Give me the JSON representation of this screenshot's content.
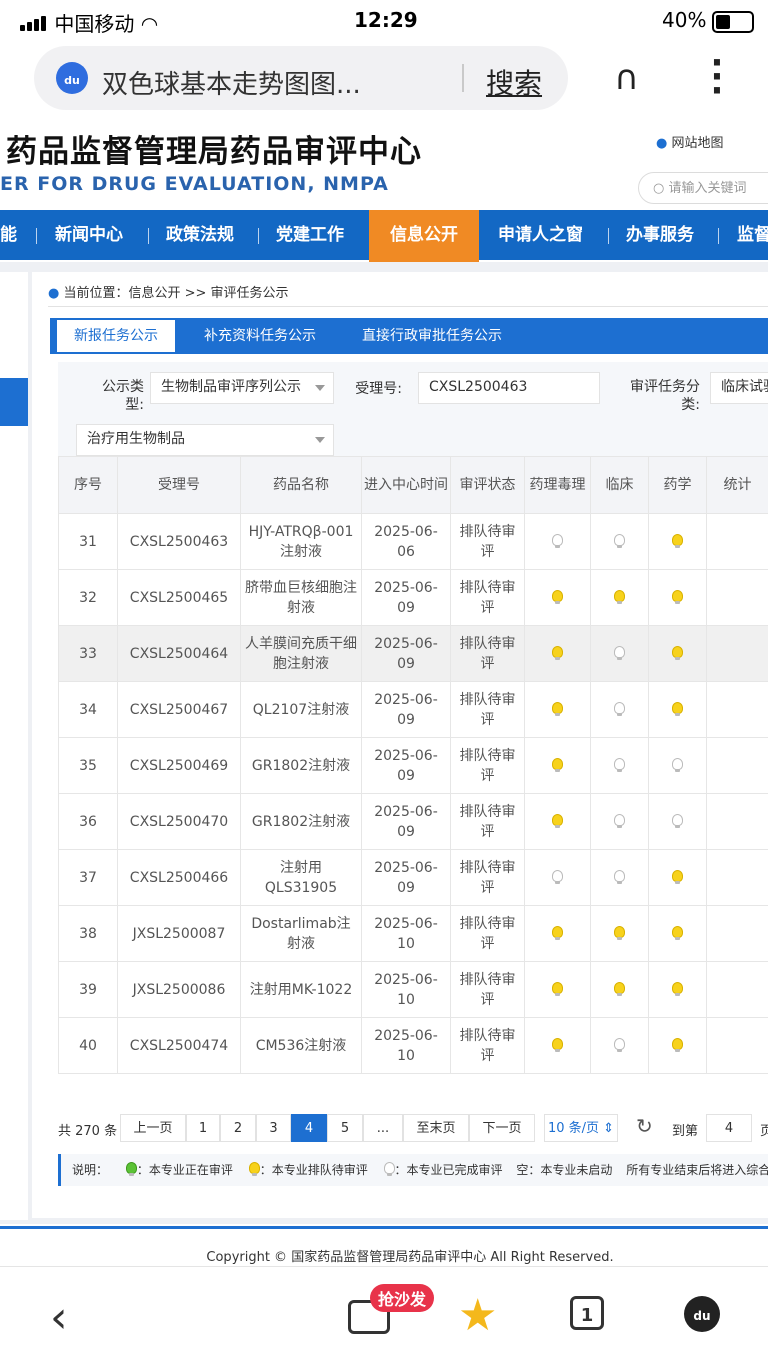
{
  "status_bar": {
    "carrier": "中国移动",
    "time": "12:29",
    "battery": "40%"
  },
  "browser": {
    "search_text": "双色球基本走势图图...",
    "search_button": "搜索",
    "logo_text": "du"
  },
  "site": {
    "title": "药品监督管理局药品审评中心",
    "subtitle": "ER FOR DRUG EVALUATION, NMPA",
    "sitemap": "网站地图",
    "search_placeholder": "请输入关键词"
  },
  "nav": {
    "items": [
      "能",
      "新闻中心",
      "政策法规",
      "党建工作",
      "信息公开",
      "申请人之窗",
      "办事服务",
      "监督"
    ],
    "active": "信息公开"
  },
  "breadcrumb": "当前位置：信息公开 >> 审评任务公示",
  "tabs": [
    "新报任务公示",
    "补充资料任务公示",
    "直接行政审批任务公示"
  ],
  "filters": {
    "type_label": "公示类型:",
    "type_value": "生物制品审评序列公示",
    "accept_label": "受理号:",
    "accept_value": "CXSL2500463",
    "category_label": "审评任务分类:",
    "category_value": "临床试验",
    "subtype_value": "治疗用生物制品"
  },
  "table": {
    "headers": [
      "序号",
      "受理号",
      "药品名称",
      "进入中心时间",
      "审评状态",
      "药理毒理",
      "临床",
      "药学",
      "统计"
    ],
    "rows": [
      {
        "no": "31",
        "id": "CXSL2500463",
        "name": "HJY-ATRQβ-001注射液",
        "date": "2025-06-06",
        "status": "排队待审评",
        "pharm": "gray",
        "clin": "gray",
        "chem": "yellow"
      },
      {
        "no": "32",
        "id": "CXSL2500465",
        "name": "脐带血巨核细胞注射液",
        "date": "2025-06-09",
        "status": "排队待审评",
        "pharm": "yellow",
        "clin": "yellow",
        "chem": "yellow"
      },
      {
        "no": "33",
        "id": "CXSL2500464",
        "name": "人羊膜间充质干细胞注射液",
        "date": "2025-06-09",
        "status": "排队待审评",
        "pharm": "yellow",
        "clin": "gray",
        "chem": "yellow"
      },
      {
        "no": "34",
        "id": "CXSL2500467",
        "name": "QL2107注射液",
        "date": "2025-06-09",
        "status": "排队待审评",
        "pharm": "yellow",
        "clin": "gray",
        "chem": "yellow"
      },
      {
        "no": "35",
        "id": "CXSL2500469",
        "name": "GR1802注射液",
        "date": "2025-06-09",
        "status": "排队待审评",
        "pharm": "yellow",
        "clin": "gray",
        "chem": "gray"
      },
      {
        "no": "36",
        "id": "CXSL2500470",
        "name": "GR1802注射液",
        "date": "2025-06-09",
        "status": "排队待审评",
        "pharm": "yellow",
        "clin": "gray",
        "chem": "gray"
      },
      {
        "no": "37",
        "id": "CXSL2500466",
        "name": "注射用QLS31905",
        "date": "2025-06-09",
        "status": "排队待审评",
        "pharm": "gray",
        "clin": "gray",
        "chem": "yellow"
      },
      {
        "no": "38",
        "id": "JXSL2500087",
        "name": "Dostarlimab注射液",
        "date": "2025-06-10",
        "status": "排队待审评",
        "pharm": "yellow",
        "clin": "yellow",
        "chem": "yellow"
      },
      {
        "no": "39",
        "id": "JXSL2500086",
        "name": "注射用MK-1022",
        "date": "2025-06-10",
        "status": "排队待审评",
        "pharm": "yellow",
        "clin": "yellow",
        "chem": "yellow"
      },
      {
        "no": "40",
        "id": "CXSL2500474",
        "name": "CM536注射液",
        "date": "2025-06-10",
        "status": "排队待审评",
        "pharm": "yellow",
        "clin": "gray",
        "chem": "yellow"
      }
    ]
  },
  "pagination": {
    "total": "共 270 条",
    "prev": "上一页",
    "pages": [
      "1",
      "2",
      "3",
      "4",
      "5",
      "..."
    ],
    "current": "4",
    "last": "至末页",
    "next": "下一页",
    "per_page": "10 条/页",
    "goto_label": "到第",
    "goto_value": "4",
    "page_suffix": "页"
  },
  "legend": {
    "prefix": "说明：",
    "green": "：本专业正在审评",
    "yellow": "：本专业排队待审评",
    "gray": "：本专业已完成审评",
    "empty": "空：本专业未启动",
    "note": "所有专业结束后将进入综合"
  },
  "footer": {
    "copyright": "Copyright © 国家药品监督管理局药品审评中心    All Right Reserved."
  },
  "bottom_bar": {
    "sofa": "抢沙发",
    "tab_count": "1",
    "logo_text": "du"
  },
  "colors": {
    "nav_blue": "#1368c4",
    "active_orange": "#f08a24",
    "accent_blue": "#1d6fd1",
    "highlight_red": "#d32f2f"
  }
}
